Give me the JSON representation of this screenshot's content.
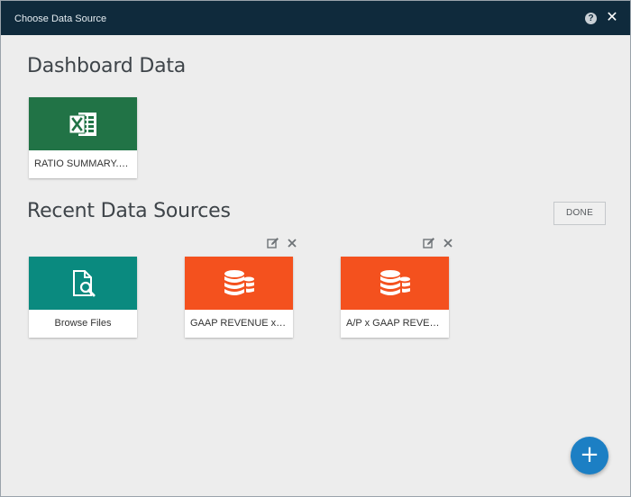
{
  "window": {
    "title": "Choose Data Source",
    "help_label": "?",
    "close_label": "✕"
  },
  "dashboard": {
    "heading": "Dashboard Data",
    "items": [
      {
        "label": "RATIO SUMMARY.xl...",
        "icon": "excel-icon",
        "color": "#217346"
      }
    ]
  },
  "recent": {
    "heading": "Recent Data Sources",
    "done_label": "DONE",
    "items": [
      {
        "label": "Browse Files",
        "icon": "browse-files-icon",
        "color": "#0a8a7f"
      },
      {
        "label": "GAAP REVENUE x A/P",
        "icon": "database-icon",
        "color": "#f4511e"
      },
      {
        "label": "A/P x GAAP REVENUE",
        "icon": "database-icon",
        "color": "#f4511e"
      }
    ]
  },
  "fab": {
    "label": "+"
  }
}
